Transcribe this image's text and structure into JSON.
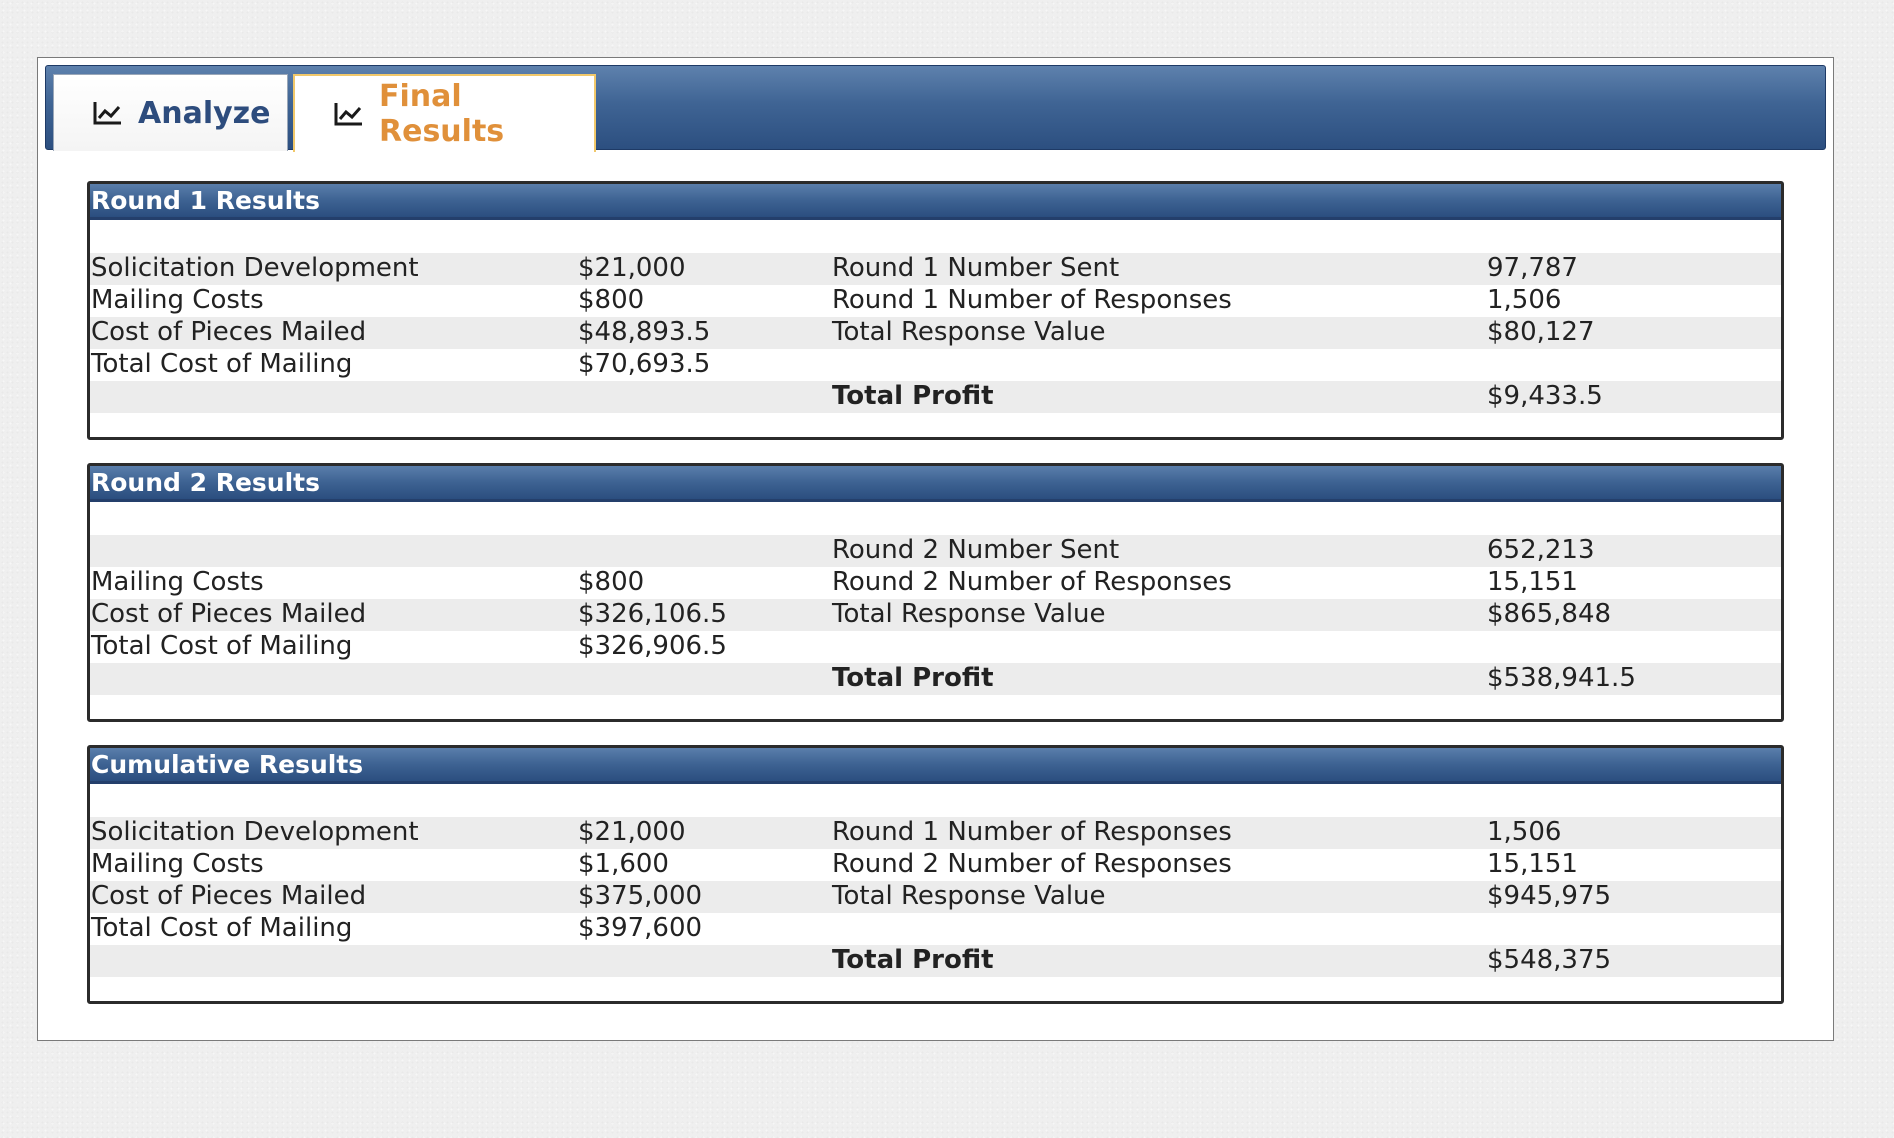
{
  "tabs": [
    {
      "label": "Analyze",
      "icon": "line-chart-icon",
      "active": false
    },
    {
      "label": "Final Results",
      "icon": "line-chart-icon",
      "active": true
    }
  ],
  "panels": [
    {
      "title": "Round 1 Results",
      "rows": [
        [
          "Solicitation Development",
          "$21,000",
          "Round 1 Number Sent",
          "97,787"
        ],
        [
          "Mailing Costs",
          "$800",
          "Round 1 Number of Responses",
          "1,506"
        ],
        [
          "Cost of Pieces Mailed",
          "$48,893.5",
          "Total Response Value",
          "$80,127"
        ],
        [
          "Total Cost of Mailing",
          "$70,693.5",
          "",
          ""
        ],
        [
          "",
          "",
          "Total Profit",
          "$9,433.5"
        ]
      ]
    },
    {
      "title": "Round 2 Results",
      "rows": [
        [
          "",
          "",
          "Round 2 Number Sent",
          "652,213"
        ],
        [
          "Mailing Costs",
          "$800",
          "Round 2 Number of Responses",
          "15,151"
        ],
        [
          "Cost of Pieces Mailed",
          "$326,106.5",
          "Total Response Value",
          "$865,848"
        ],
        [
          "Total Cost of Mailing",
          "$326,906.5",
          "",
          ""
        ],
        [
          "",
          "",
          "Total Profit",
          "$538,941.5"
        ]
      ]
    },
    {
      "title": "Cumulative Results",
      "rows": [
        [
          "Solicitation Development",
          "$21,000",
          "Round 1 Number of Responses",
          "1,506"
        ],
        [
          "Mailing Costs",
          "$1,600",
          "Round 2 Number of Responses",
          "15,151"
        ],
        [
          "Cost of Pieces Mailed",
          "$375,000",
          "Total Response Value",
          "$945,975"
        ],
        [
          "Total Cost of Mailing",
          "$397,600",
          "",
          ""
        ],
        [
          "",
          "",
          "Total Profit",
          "$548,375"
        ]
      ]
    }
  ],
  "colors": {
    "header_blue": "#3d6292",
    "active_tab_text": "#e0903a",
    "inactive_tab_text": "#2d4c7d"
  }
}
